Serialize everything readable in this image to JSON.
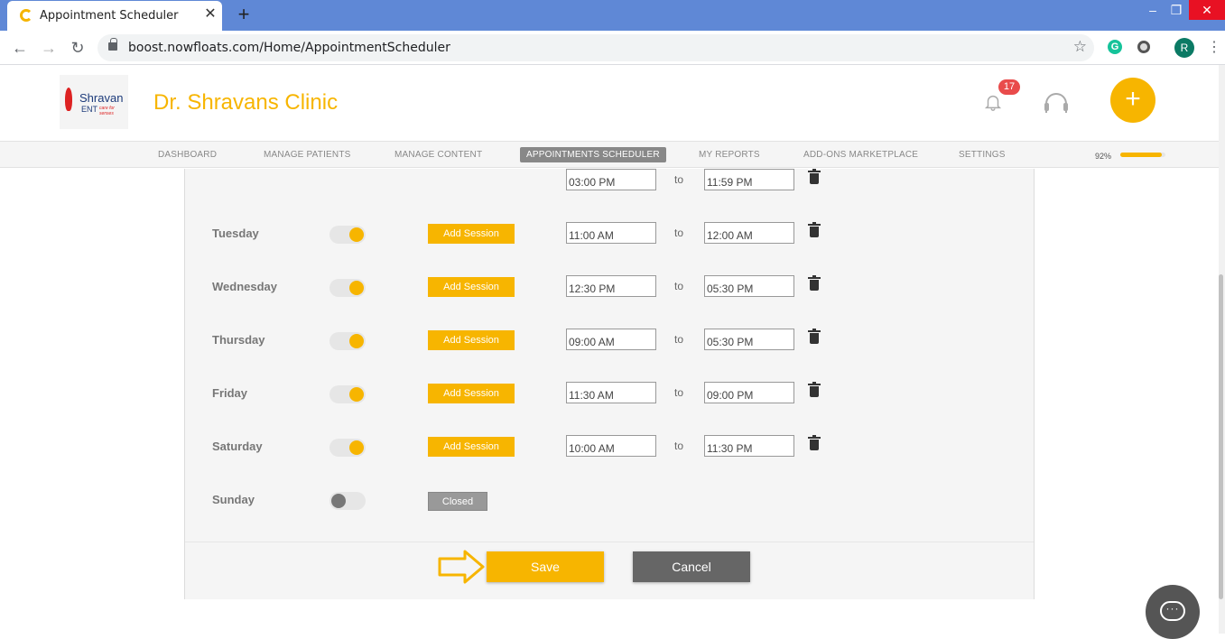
{
  "browser": {
    "tab_title": "Appointment Scheduler",
    "tab_close": "✕",
    "new_tab": "+",
    "url": "boost.nowfloats.com/Home/AppointmentScheduler",
    "profile_initial": "R",
    "extension_initial": "G"
  },
  "header": {
    "logo": {
      "line1": "Shravan",
      "line2": "ENT",
      "tagline": "care for senses"
    },
    "clinic_name": "Dr. Shravans Clinic",
    "notification_count": "17",
    "plus_label": "+"
  },
  "nav": {
    "items": [
      {
        "label": "DASHBOARD",
        "active": false
      },
      {
        "label": "MANAGE PATIENTS",
        "active": false
      },
      {
        "label": "MANAGE CONTENT",
        "active": false
      },
      {
        "label": "APPOINTMENTS SCHEDULER",
        "active": true
      },
      {
        "label": "MY REPORTS",
        "active": false
      },
      {
        "label": "ADD-ONS MARKETPLACE",
        "active": false
      },
      {
        "label": "SETTINGS",
        "active": false
      }
    ],
    "progress_label": "92%",
    "progress_value": 0.92
  },
  "schedule": {
    "partial_row": {
      "start": "03:00 PM",
      "to": "to",
      "end": "11:59 PM"
    },
    "days": [
      {
        "day": "Tuesday",
        "enabled": true,
        "action": "Add Session",
        "start": "11:00 AM",
        "to": "to",
        "end": "12:00 AM"
      },
      {
        "day": "Wednesday",
        "enabled": true,
        "action": "Add Session",
        "start": "12:30 PM",
        "to": "to",
        "end": "05:30 PM"
      },
      {
        "day": "Thursday",
        "enabled": true,
        "action": "Add Session",
        "start": "09:00 AM",
        "to": "to",
        "end": "05:30 PM"
      },
      {
        "day": "Friday",
        "enabled": true,
        "action": "Add Session",
        "start": "11:30 AM",
        "to": "to",
        "end": "09:00 PM"
      },
      {
        "day": "Saturday",
        "enabled": true,
        "action": "Add Session",
        "start": "10:00 AM",
        "to": "to",
        "end": "11:30 PM"
      },
      {
        "day": "Sunday",
        "enabled": false,
        "action": "Closed"
      }
    ]
  },
  "actions": {
    "save": "Save",
    "cancel": "Cancel"
  },
  "colors": {
    "accent": "#f7b500",
    "chrome_tab_bar": "#5f88d6",
    "cancel": "#666666",
    "badge": "#e94b4b"
  }
}
